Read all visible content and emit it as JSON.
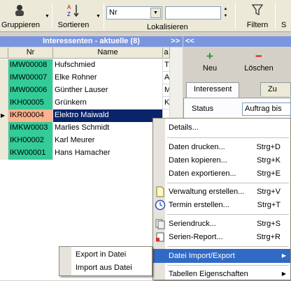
{
  "toolbar": {
    "group_label": "Gruppieren",
    "sort_label": "Sortieren",
    "field_select": "Nr",
    "search_value": "",
    "locate_label": "Lokalisieren",
    "filter_label": "Filtern",
    "cut_label": "S"
  },
  "list_panel": {
    "title": "Interessenten - aktuelle (8)",
    "collapse_glyph": ">>",
    "columns": [
      "Nr",
      "Name",
      "a"
    ],
    "rows": [
      {
        "nr": "IMW00008",
        "name": "Hufschmied",
        "x": "T",
        "color": "#33cc99"
      },
      {
        "nr": "IMW00007",
        "name": "Elke Rohner",
        "x": "A",
        "color": "#33cc99"
      },
      {
        "nr": "IMW00006",
        "name": "Günther Lauser",
        "x": "M",
        "color": "#33cc99"
      },
      {
        "nr": "IKH00005",
        "name": "Grünkern",
        "x": "K",
        "color": "#33cc99"
      },
      {
        "nr": "IKR00004",
        "name": "Elektro Maiwald",
        "x": "",
        "color": "#ffb08c"
      },
      {
        "nr": "IMKW0003",
        "name": "Marlies Schmidt",
        "x": "",
        "color": "#33cc99"
      },
      {
        "nr": "IKH00002",
        "name": "Karl Meurer",
        "x": "",
        "color": "#33cc99"
      },
      {
        "nr": "IKW00001",
        "name": "Hans Hamacher",
        "x": "",
        "color": "#33cc99"
      }
    ],
    "selected_index": 4
  },
  "detail_panel": {
    "expand_glyph": "<<",
    "new_label": "Neu",
    "delete_label": "Löschen",
    "tabs": [
      "Interessent",
      "Zu"
    ],
    "status_label": "Status",
    "status_value": "Auftrag bis"
  },
  "context_menu": {
    "items": [
      {
        "label": "Details...",
        "shortcut": ""
      },
      {
        "label": "Daten drucken...",
        "shortcut": "Strg+D"
      },
      {
        "label": "Daten kopieren...",
        "shortcut": "Strg+K"
      },
      {
        "label": "Daten exportieren...",
        "shortcut": "Strg+E"
      },
      {
        "label": "Verwaltung erstellen...",
        "shortcut": "Strg+V"
      },
      {
        "label": "Termin erstellen...",
        "shortcut": "Strg+T"
      },
      {
        "label": "Seriendruck...",
        "shortcut": "Strg+S"
      },
      {
        "label": "Serien-Report...",
        "shortcut": "Strg+R"
      },
      {
        "label": "Datei Import/Export",
        "shortcut": ""
      },
      {
        "label": "Tabellen Eigenschaften",
        "shortcut": ""
      }
    ],
    "submenu": [
      "Export in Datei",
      "Import aus Datei"
    ]
  },
  "colors": {
    "selection": "#0a246a",
    "menu_highlight": "#316ac5",
    "header_blue": "#7a96df",
    "nr_green": "#33cc99",
    "nr_orange": "#ffb08c"
  }
}
